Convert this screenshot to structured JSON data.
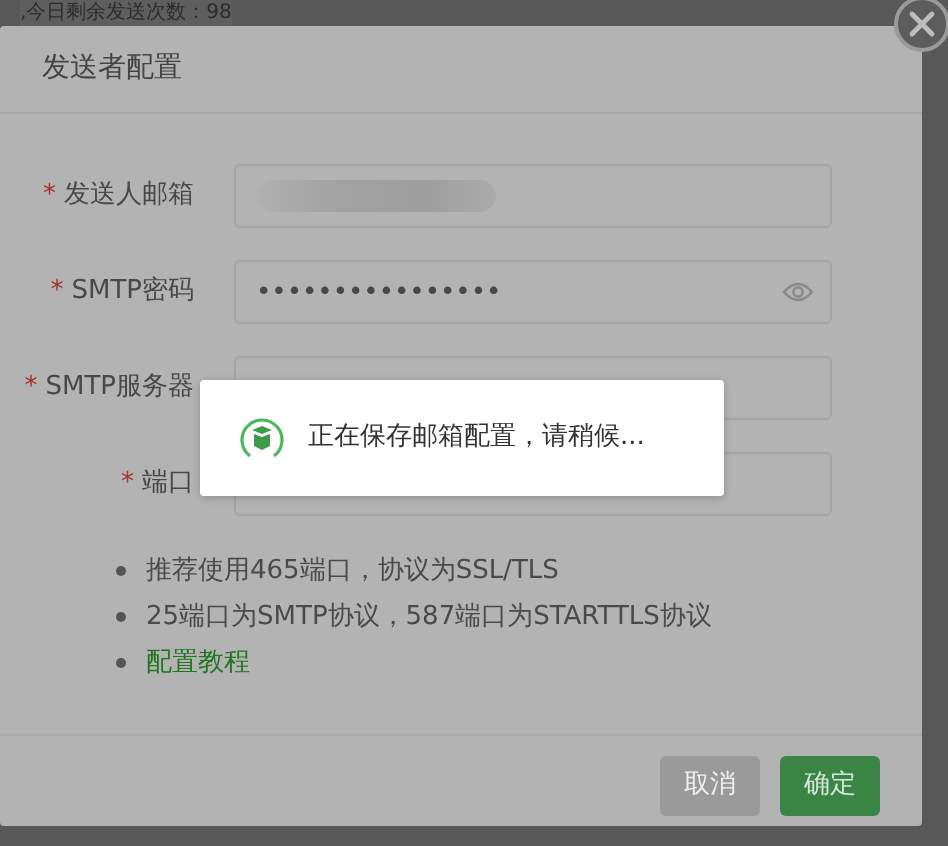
{
  "background_text": ",今日剩余发送次数：98",
  "dialog": {
    "title": "发送者配置",
    "fields": [
      {
        "label": "发送人邮箱",
        "marker": "*",
        "kind": "redacted"
      },
      {
        "label": "SMTP密码",
        "marker": "*",
        "kind": "password",
        "value": "••••••••••••••••"
      },
      {
        "label": "SMTP服务器",
        "marker": "*",
        "kind": "text"
      },
      {
        "label": "端口",
        "marker": "*",
        "kind": "text"
      }
    ],
    "notes": [
      {
        "text": "推荐使用465端口，协议为SSL/TLS",
        "kind": "text"
      },
      {
        "text": "25端口为SMTP协议，587端口为STARTTLS协议",
        "kind": "text"
      },
      {
        "text": "配置教程",
        "kind": "link"
      }
    ],
    "buttons": [
      {
        "label": "取消",
        "kind": "secondary"
      },
      {
        "label": "确定",
        "kind": "primary"
      }
    ]
  },
  "toast": {
    "message": "正在保存邮箱配置，请稍候..."
  }
}
